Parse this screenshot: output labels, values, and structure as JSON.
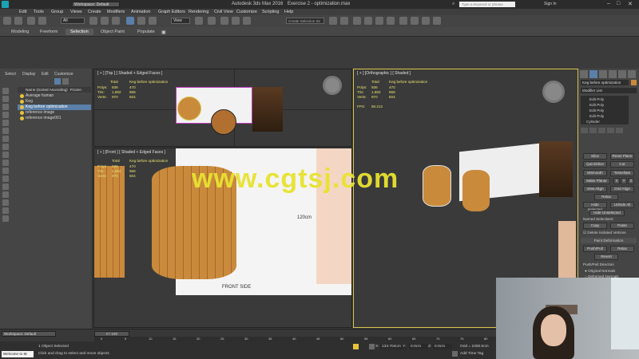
{
  "titlebar": {
    "workspace": "Workspace: Default",
    "app_title": "Autodesk 3ds Max 2016",
    "file_title": "Exercise 2 - optimization.max",
    "search_placeholder": "Type a keyword or phrase",
    "sign_in": "Sign In"
  },
  "menu": [
    "Edit",
    "Tools",
    "Group",
    "Views",
    "Create",
    "Modifiers",
    "Animation",
    "Graph Editors",
    "Rendering",
    "Civil View",
    "Customize",
    "Scripting",
    "Help"
  ],
  "toolbar": {
    "filter_value": "All",
    "view_value": "View",
    "selection_set_placeholder": "Create Selection Se"
  },
  "ribbon_tabs": [
    "Modeling",
    "Freeform",
    "Selection",
    "Object Paint",
    "Populate"
  ],
  "ribbon_active": "Selection",
  "scene_explorer": {
    "tabs": [
      "Select",
      "Display",
      "Edit",
      "Customize"
    ],
    "header_name": "Name (Sorted Ascending)",
    "header_frozen": "Frozen",
    "items": [
      "Average human",
      "Keg",
      "Keg before optimization",
      "reference image",
      "reference image001"
    ],
    "selected_index": 2
  },
  "viewports": {
    "top": {
      "label": "[ + ] [Top ] [ Shaded + Edged Faces ]",
      "stats_header": [
        "Total",
        "Keg before optimization"
      ],
      "stats": [
        [
          "Polys:",
          "936",
          "470"
        ],
        [
          "Tris:",
          "1,882",
          "968"
        ],
        [
          "Verts:",
          "970",
          "504"
        ]
      ]
    },
    "front": {
      "label": "[ + ] [Front ] [ Shaded + Edged Faces ]",
      "stats_header": [
        "Total",
        "Keg before optimization"
      ],
      "stats": [
        [
          "Polys:",
          "936",
          "470"
        ],
        [
          "Tris:",
          "1,882",
          "968"
        ],
        [
          "Verts:",
          "970",
          "504"
        ]
      ],
      "dimension_text": "120cm",
      "side_text": "FRONT SIDE"
    },
    "persp": {
      "label": "[ + ] [Orthographic ] [ Shaded ]",
      "stats_header": [
        "Total",
        "Keg before optimization"
      ],
      "stats": [
        [
          "Polys:",
          "936",
          "470"
        ],
        [
          "Tris:",
          "1,882",
          "968"
        ],
        [
          "Verts:",
          "970",
          "504"
        ]
      ],
      "fps_label": "FPS:",
      "fps_value": "66.212"
    }
  },
  "command_panel": {
    "object_name": "Keg before optimization",
    "modifier_list": "Modifier List",
    "stack": [
      "Edit Poly",
      "Edit Poly",
      "Edit Poly",
      "Edit Poly",
      "Cylinder"
    ],
    "buttons": [
      "Slice",
      "Reset Plane",
      "QuickSlice",
      "Cut",
      "MSmooth",
      "Tessellate",
      "Make Planar",
      "X",
      "Y",
      "Z",
      "View Align",
      "Grid Align",
      "Relax",
      "Hide Selected",
      "Unhide All",
      "Hide Unselected",
      "Copy",
      "Paste"
    ],
    "named_selections": "Named Selections:",
    "delete_isolated": "Delete Isolated Vertices",
    "paint_deformation": "Paint Deformation",
    "push_pull": "Push/Pull",
    "relax_btn": "Relax",
    "revert": "Revert",
    "push_pull_direction": "Push/Pull Direction",
    "original_normals": "Original Normals",
    "deformed_normals": "Deformed Normals"
  },
  "timeline": {
    "frame_display": "0 / 100",
    "ticks": [
      "0",
      "5",
      "10",
      "15",
      "20",
      "25",
      "30",
      "35",
      "40",
      "45",
      "50",
      "55",
      "60",
      "65",
      "70",
      "75",
      "80",
      "85",
      "90",
      "95",
      "100"
    ]
  },
  "status": {
    "workspace": "Workspace: Default",
    "maxscript": "Welcome to M:",
    "objects_selected": "1 Object Selected",
    "prompt": "Click and drag to select and move objects",
    "x_label": "X:",
    "x_value": "133.704cm",
    "y_label": "Y:",
    "y_value": "0.0cm",
    "z_label": "Z:",
    "z_value": "0.0cm",
    "grid": "Grid = 1000.0cm",
    "add_time_tag": "Add Time Tag"
  },
  "watermark": "www.cgtsj.com",
  "colors": {
    "selection_blue": "#5a7fa8",
    "stat_yellow": "#e8e070",
    "keg_wood": "#c98a3c",
    "watermark": "#e8e330",
    "active_border": "#d8c34a"
  }
}
